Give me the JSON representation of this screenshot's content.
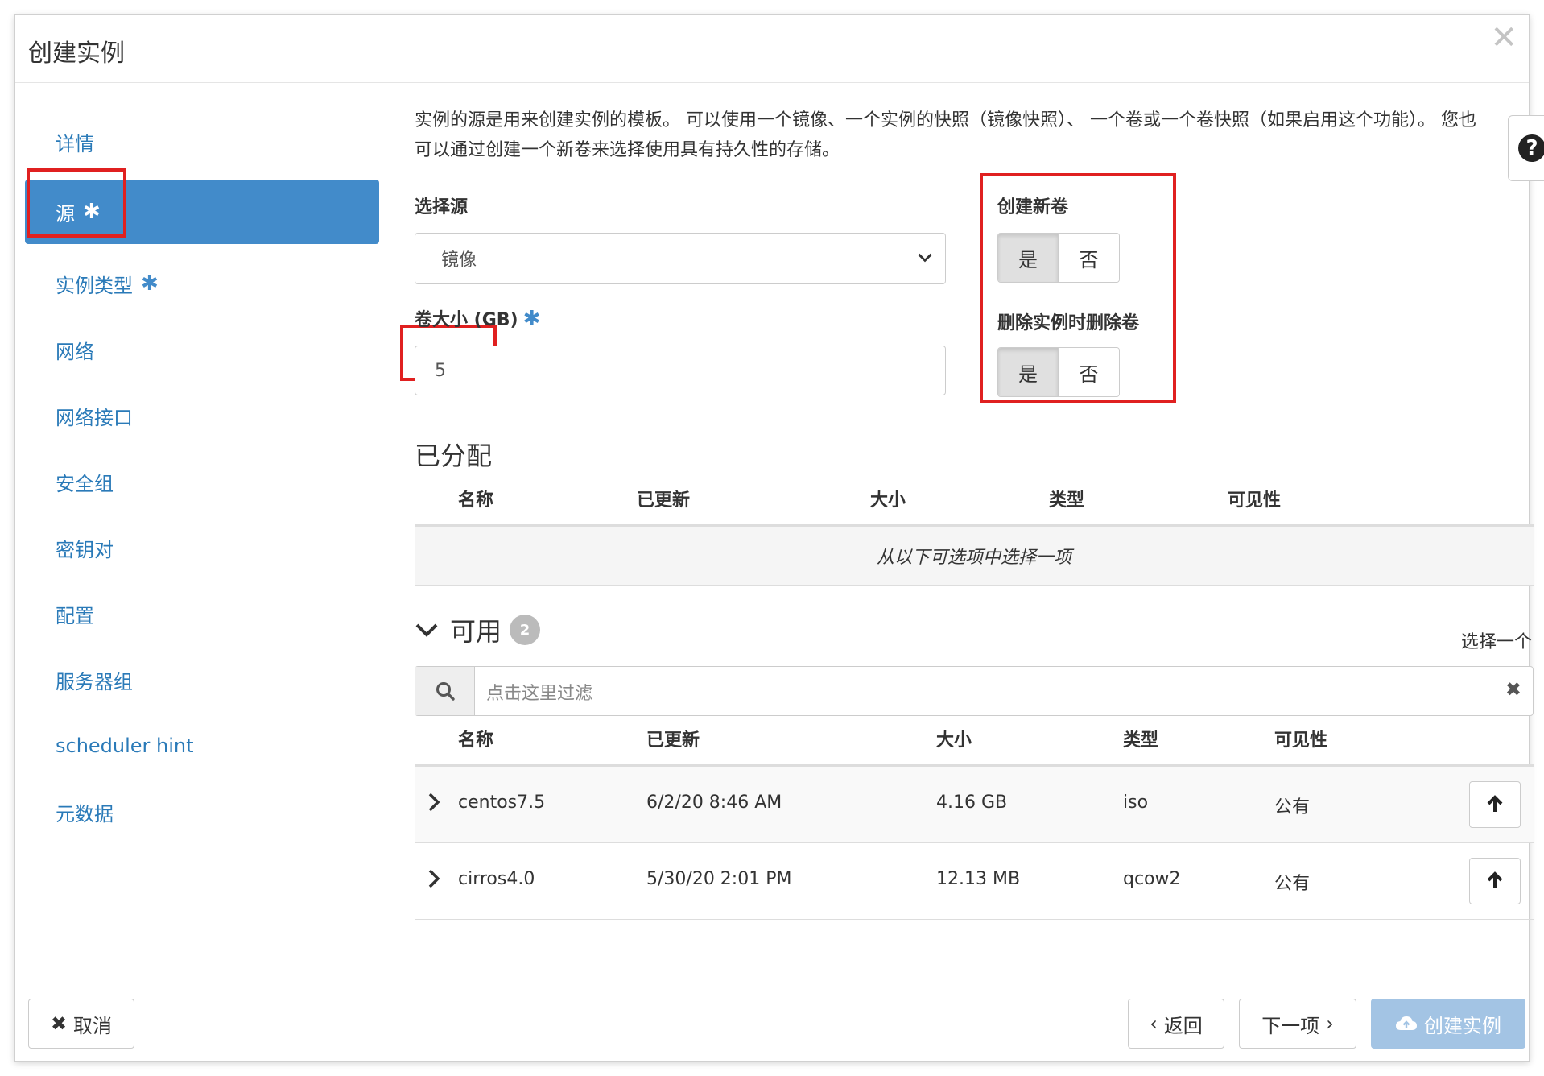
{
  "dialog": {
    "title": "创建实例"
  },
  "nav": {
    "items": [
      {
        "label": "详情",
        "required": false
      },
      {
        "label": "源",
        "required": true
      },
      {
        "label": "实例类型",
        "required": true
      },
      {
        "label": "网络",
        "required": false
      },
      {
        "label": "网络接口",
        "required": false
      },
      {
        "label": "安全组",
        "required": false
      },
      {
        "label": "密钥对",
        "required": false
      },
      {
        "label": "配置",
        "required": false
      },
      {
        "label": "服务器组",
        "required": false
      },
      {
        "label": "scheduler hint",
        "required": false
      },
      {
        "label": "元数据",
        "required": false
      }
    ],
    "required_mark": "✱"
  },
  "help": {
    "text": "实例的源是用来创建实例的模板。 可以使用一个镜像、一个实例的快照（镜像快照）、 一个卷或一个卷快照（如果启用这个功能）。 您也可以通过创建一个新卷来选择使用具有持久性的存储。",
    "button": "?"
  },
  "form": {
    "source_label": "选择源",
    "source_value": "镜像",
    "volume_size_label": "卷大小 (GB)",
    "volume_size_value": "5",
    "create_volume_label": "创建新卷",
    "delete_volume_label": "删除实例时删除卷",
    "yes": "是",
    "no": "否"
  },
  "allocated": {
    "title": "已分配",
    "columns": [
      "名称",
      "已更新",
      "大小",
      "类型",
      "可见性"
    ],
    "empty": "从以下可选项中选择一项"
  },
  "available": {
    "title": "可用",
    "count": "2",
    "select_one": "选择一个",
    "filter_placeholder": "点击这里过滤",
    "columns": [
      "名称",
      "已更新",
      "大小",
      "类型",
      "可见性"
    ],
    "rows": [
      {
        "name": "centos7.5",
        "updated": "6/2/20 8:46 AM",
        "size": "4.16 GB",
        "type": "iso",
        "visibility": "公有"
      },
      {
        "name": "cirros4.0",
        "updated": "5/30/20 2:01 PM",
        "size": "12.13 MB",
        "type": "qcow2",
        "visibility": "公有"
      }
    ]
  },
  "footer": {
    "cancel": "取消",
    "back": "返回",
    "next": "下一项",
    "create": "创建实例"
  },
  "colors": {
    "accent": "#428bca",
    "link": "#2a7ab8",
    "highlight": "#e02020"
  }
}
